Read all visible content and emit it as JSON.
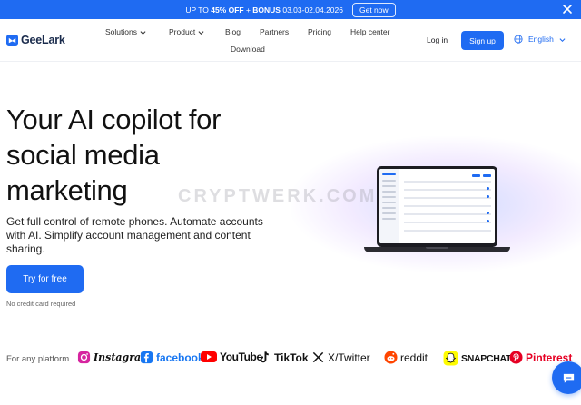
{
  "promo": {
    "text_lead": "UP TO ",
    "text_discount": "45% OFF",
    "text_mid": " + ",
    "text_bonus": "BONUS",
    "text_dates": " 03.03-02.04.2026",
    "button": "Get now"
  },
  "nav": {
    "brand": "GeeLark",
    "items": {
      "solutions": "Solutions",
      "product": "Product",
      "blog": "Blog",
      "partners": "Partners",
      "pricing": "Pricing",
      "help": "Help center",
      "download": "Download"
    },
    "login": "Log in",
    "signup": "Sign up",
    "language": "English"
  },
  "hero": {
    "title_lines": [
      "Your AI copilot for",
      "social media",
      "marketing"
    ],
    "subtitle": "Get full control of remote phones. Automate accounts with AI. Simplify account management and content sharing.",
    "cta": "Try for free",
    "note": "No credit card required"
  },
  "watermark": "CRYPTWERK.COM",
  "platforms": {
    "label": "For any platform",
    "items": [
      "Instagram",
      "facebook",
      "YouTube",
      "TikTok",
      "X/Twitter",
      "reddit",
      "SNAPCHAT",
      "Pinterest"
    ]
  },
  "colors": {
    "brand": "#1f6bf2",
    "instagram": "#d6249f",
    "facebook": "#1877f2",
    "youtube": "#ff0000",
    "reddit": "#ff4500",
    "snapchat": "#fffc00",
    "pinterest": "#e60023"
  },
  "icons": {
    "close": "close-icon",
    "globe": "globe-icon",
    "chat": "chat-icon"
  }
}
